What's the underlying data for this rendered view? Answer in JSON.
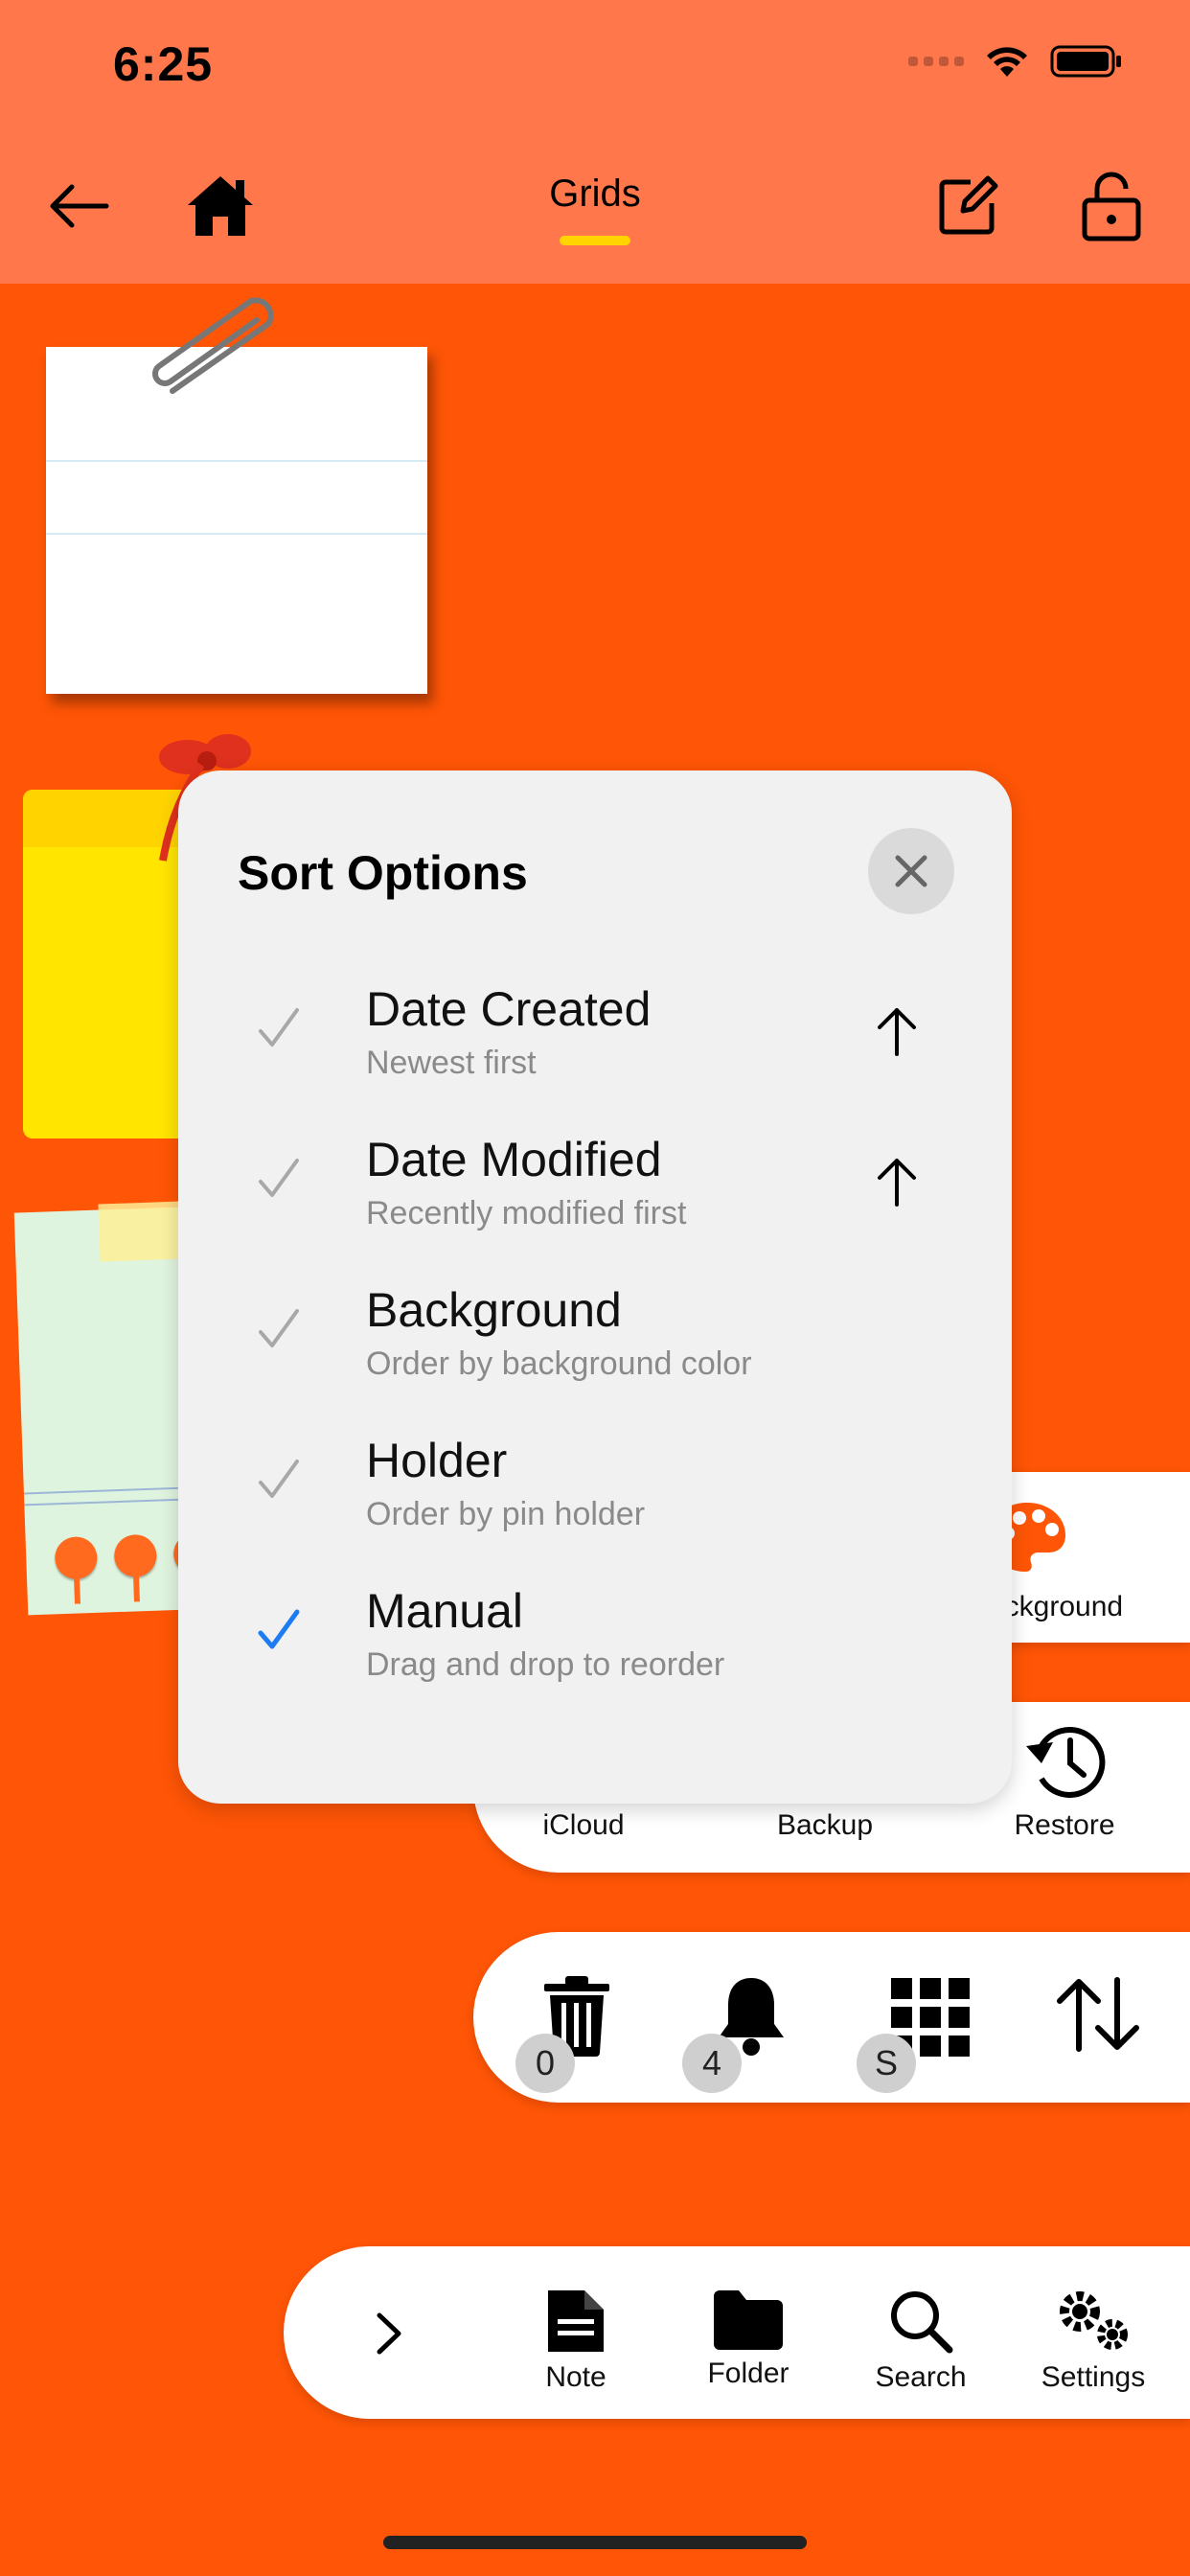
{
  "status_bar": {
    "time": "6:25"
  },
  "header": {
    "title": "Grids"
  },
  "sort_options": {
    "title": "Sort Options",
    "options": [
      {
        "title": "Date Created",
        "subtitle": "Newest first",
        "selected": false,
        "direction": "up"
      },
      {
        "title": "Date Modified",
        "subtitle": "Recently modified first",
        "selected": false,
        "direction": "up"
      },
      {
        "title": "Background",
        "subtitle": "Order by background color",
        "selected": false
      },
      {
        "title": "Holder",
        "subtitle": "Order by pin holder",
        "selected": false
      },
      {
        "title": "Manual",
        "subtitle": "Drag and drop to reorder",
        "selected": true
      }
    ]
  },
  "toolbar_background": {
    "label": "ackground"
  },
  "toolbar_sync": {
    "icloud": "iCloud",
    "backup": "Backup",
    "restore": "Restore"
  },
  "toolbar_actions": {
    "trash_count": "0",
    "reminder_count": "4",
    "grid_size": "S"
  },
  "bottom_bar": {
    "note": "Note",
    "folder": "Folder",
    "search": "Search",
    "settings": "Settings"
  },
  "colors": {
    "background": "#FF5506",
    "header": "#FF774A",
    "accent": "#FFD400",
    "selected_check": "#1E7CF2",
    "unselected_check": "#A8A8A8"
  }
}
